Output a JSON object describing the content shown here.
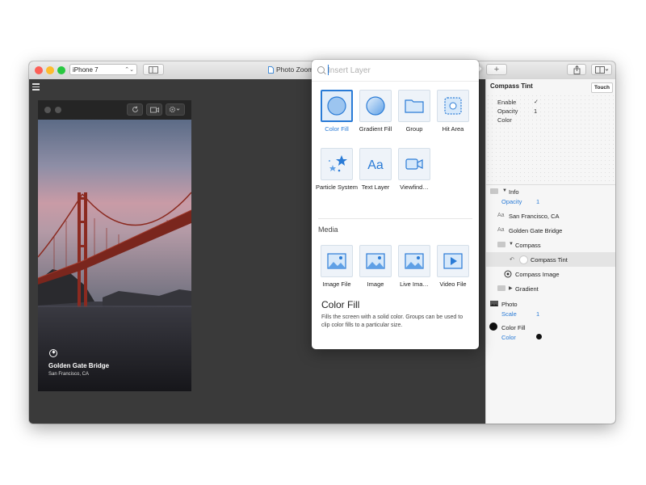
{
  "window": {
    "title": "Photo Zoom",
    "device_select": "iPhone 7",
    "device_select_chevron": "⌃⌄",
    "toolbar_icons": [
      "split-view-icon",
      "add-icon",
      "share-icon",
      "layout-icon"
    ],
    "add_label": "+"
  },
  "device": {
    "photo_title": "Golden Gate Bridge",
    "photo_subtitle": "San Francisco, CA"
  },
  "popover": {
    "search_placeholder": "Insert Layer",
    "layers": [
      {
        "label": "Color Fill",
        "icon": "color-fill-icon",
        "selected": true
      },
      {
        "label": "Gradient Fill",
        "icon": "gradient-fill-icon"
      },
      {
        "label": "Group",
        "icon": "group-folder-icon"
      },
      {
        "label": "Hit Area",
        "icon": "hit-area-icon"
      },
      {
        "label": "Particle System",
        "icon": "particle-system-icon"
      },
      {
        "label": "Text Layer",
        "icon": "text-layer-icon"
      },
      {
        "label": "Viewfind…",
        "icon": "viewfinder-icon"
      }
    ],
    "media_header": "Media",
    "media": [
      {
        "label": "Image File",
        "icon": "image-file-icon"
      },
      {
        "label": "Image",
        "icon": "image-icon"
      },
      {
        "label": "Live Ima…",
        "icon": "live-image-icon"
      },
      {
        "label": "Video File",
        "icon": "video-file-icon"
      }
    ],
    "description_title": "Color Fill",
    "description_text": "Fills the screen with a solid color. Groups can be used to clip color fills to a particular size."
  },
  "inspector": {
    "title": "Compass Tint",
    "touch_label": "Touch",
    "props": [
      {
        "label": "Enable",
        "value": "✓"
      },
      {
        "label": "Opacity",
        "value": "1"
      },
      {
        "label": "Color",
        "value": ""
      }
    ],
    "layers": [
      {
        "label": "Info",
        "kind": "folder-open"
      },
      {
        "label": "Opacity",
        "value": "1",
        "kind": "prop"
      },
      {
        "label": "San Francisco, CA",
        "kind": "text"
      },
      {
        "label": "Golden Gate Bridge",
        "kind": "text"
      },
      {
        "label": "Compass",
        "kind": "folder-open"
      },
      {
        "label": "Compass Tint",
        "kind": "tint",
        "selected": true
      },
      {
        "label": "Compass Image",
        "kind": "image"
      },
      {
        "label": "Gradient",
        "kind": "folder-closed"
      },
      {
        "label": "Photo",
        "kind": "photo"
      },
      {
        "label": "Scale",
        "value": "1",
        "kind": "prop"
      },
      {
        "label": "Color Fill",
        "kind": "fill"
      },
      {
        "label": "Color",
        "kind": "prop-swatch"
      }
    ],
    "aa_glyph": "Aa"
  },
  "colors": {
    "accent": "#2a7bd6",
    "traffic_red": "#fc5f57",
    "traffic_yellow": "#fdbc2e",
    "traffic_green": "#28c840"
  }
}
